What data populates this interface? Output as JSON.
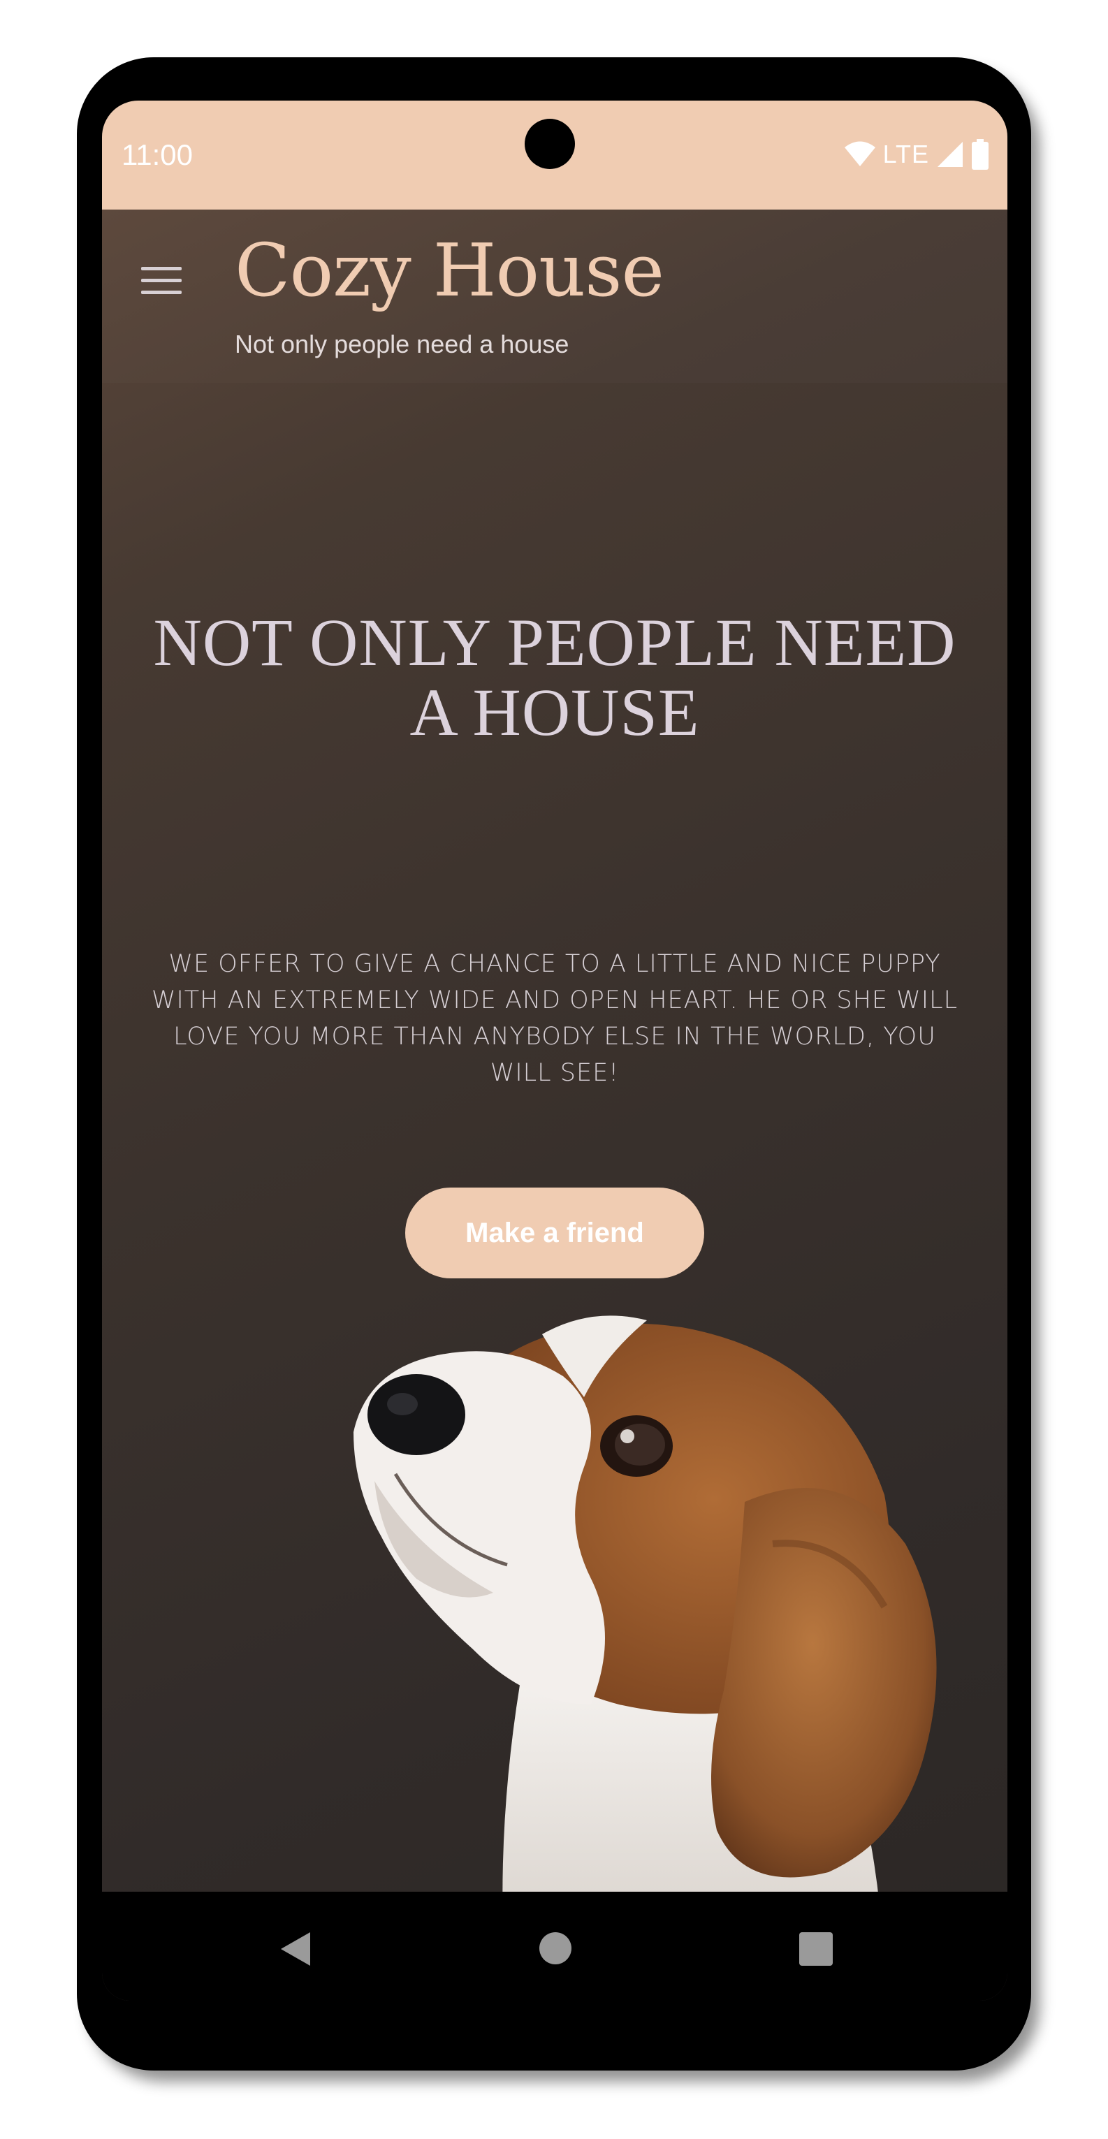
{
  "status_bar": {
    "time": "11:00",
    "network": "LTE",
    "icons": [
      "wifi-icon",
      "cellular-signal-icon",
      "battery-icon"
    ],
    "background_color": "#f0ccb2"
  },
  "header": {
    "menu_icon": "hamburger-menu-icon",
    "title": "Cozy House",
    "subtitle": "Not only people need a house"
  },
  "hero": {
    "title": "NOT ONLY PEOPLE NEED A HOUSE",
    "text": "WE OFFER TO GIVE A CHANCE TO A LITTLE AND NICE PUPPY WITH AN EXTREMELY WIDE AND OPEN HEART. HE OR SHE WILL LOVE YOU MORE THAN ANYBODY ELSE IN THE WORLD, YOU WILL SEE!",
    "cta_label": "Make a friend",
    "image": "beagle-puppy-image"
  },
  "nav_bar": {
    "icons": [
      "back-icon",
      "home-icon",
      "recents-icon"
    ]
  },
  "colors": {
    "accent": "#f0ccb2",
    "background_dark": "#2b2624",
    "hero_title": "#dcd2dc"
  }
}
